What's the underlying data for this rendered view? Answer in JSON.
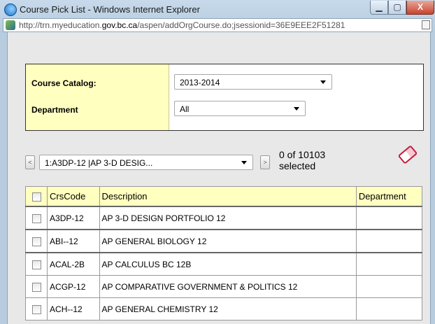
{
  "window": {
    "title": "Course Pick List - Windows Internet Explorer",
    "minimize_label": "▁",
    "maximize_label": "▢",
    "close_label": "X"
  },
  "address": {
    "url_prefix": "http://trn.myeducation.",
    "url_domain": "gov.bc.ca",
    "url_suffix": "/aspen/addOrgCourse.do;jsessionid=36E9EEE2F51281"
  },
  "filters": {
    "catalog_label": "Course Catalog:",
    "catalog_value": "2013-2014",
    "department_label": "Department",
    "department_value": "All"
  },
  "pager": {
    "prev_label": "<",
    "next_label": ">",
    "current_record": "1:A3DP-12 |AP 3-D DESIG...",
    "selected_line1": "0 of 10103",
    "selected_line2": "selected"
  },
  "table": {
    "headers": {
      "code": "CrsCode",
      "description": "Description",
      "department": "Department"
    },
    "rows": [
      {
        "code": "A3DP-12",
        "description": "AP 3-D DESIGN PORTFOLIO 12",
        "department": ""
      },
      {
        "code": "ABI--12",
        "description": "AP GENERAL BIOLOGY 12",
        "department": ""
      },
      {
        "code": "ACAL-2B",
        "description": "AP CALCULUS BC 12B",
        "department": ""
      },
      {
        "code": "ACGP-12",
        "description": "AP COMPARATIVE GOVERNMENT & POLITICS 12",
        "department": ""
      },
      {
        "code": "ACH--12",
        "description": "AP GENERAL CHEMISTRY 12",
        "department": ""
      }
    ]
  },
  "icons": {
    "browser": "ie-icon",
    "page": "page-icon",
    "compat": "compatibility-view-icon",
    "clear": "eraser-icon"
  }
}
